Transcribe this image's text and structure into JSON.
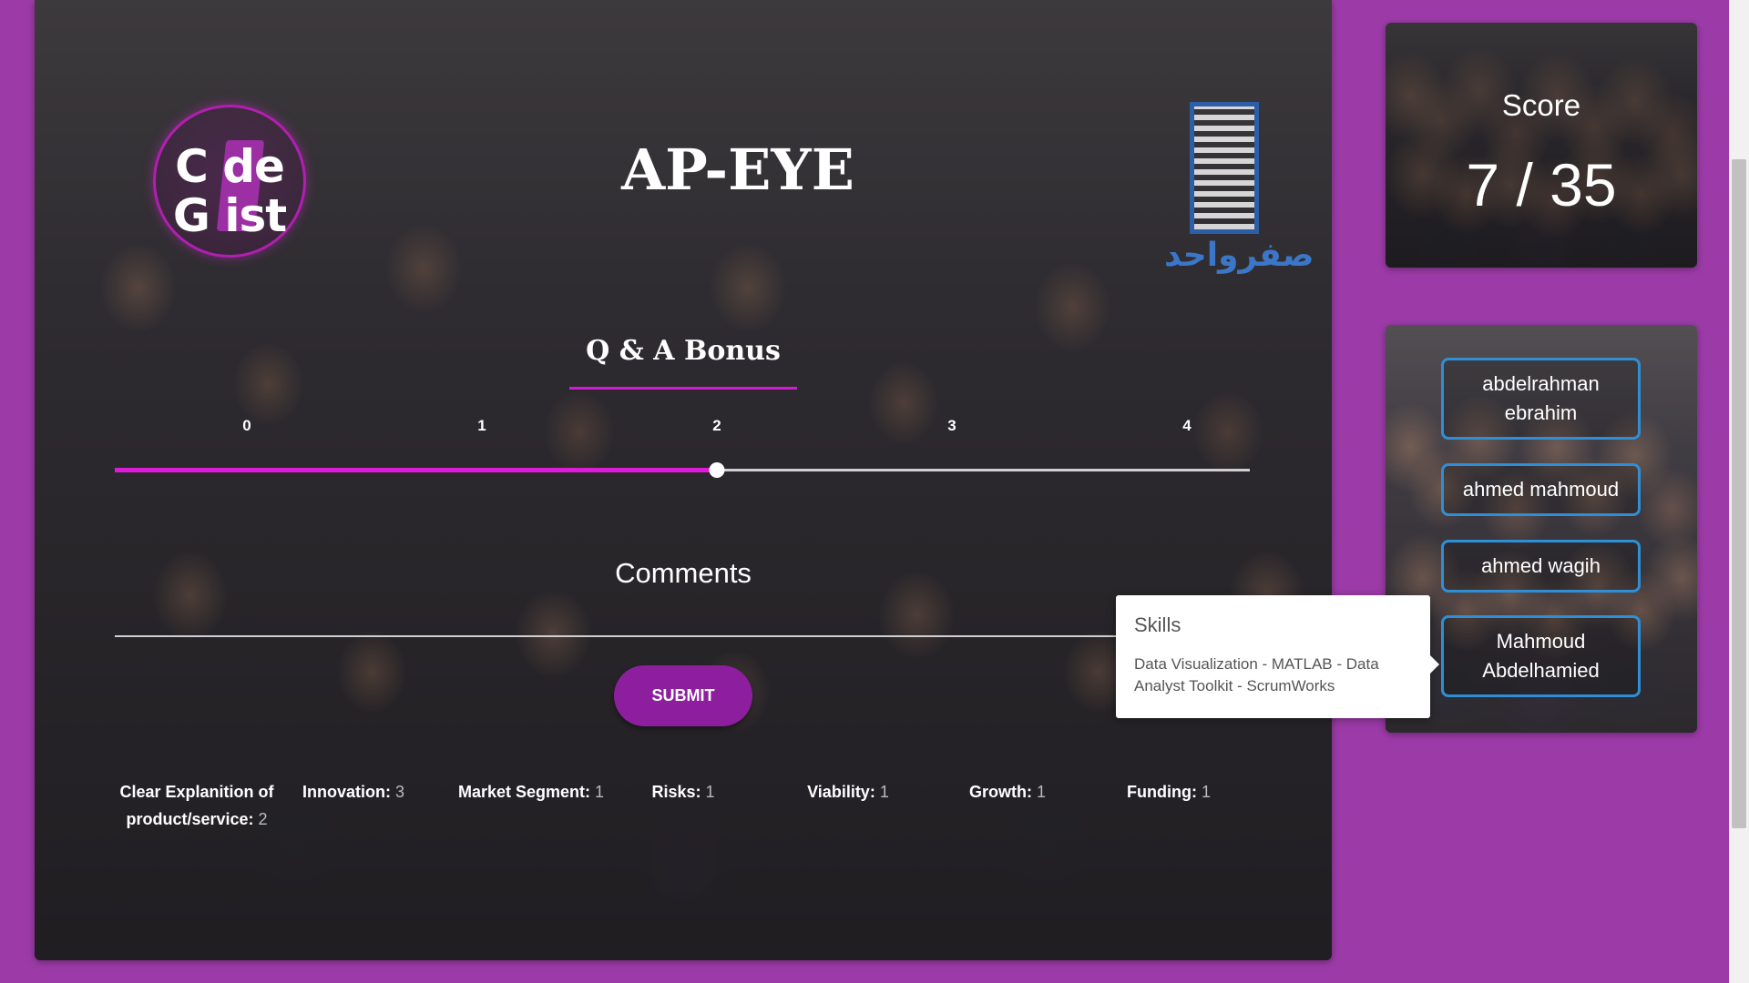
{
  "header": {
    "app_title": "AP-EYE",
    "codegist_logo": {
      "line1": "C  de",
      "line2": "G  ist",
      "name": "codegist-logo"
    },
    "sefr_logo": {
      "arabic": "صفرواحد"
    }
  },
  "qa_bonus": {
    "title": "Q & A Bonus",
    "ticks": [
      "0",
      "1",
      "2",
      "3",
      "4"
    ],
    "value": 2,
    "max": 4
  },
  "comments": {
    "label": "Comments",
    "value": ""
  },
  "submit": {
    "label": "SUBMIT"
  },
  "criteria": [
    {
      "label": "Clear Explanition of product/service:",
      "value": "2"
    },
    {
      "label": "Innovation:",
      "value": "3"
    },
    {
      "label": "Market Segment:",
      "value": "1"
    },
    {
      "label": "Risks:",
      "value": "1"
    },
    {
      "label": "Viability:",
      "value": "1"
    },
    {
      "label": "Growth:",
      "value": "1"
    },
    {
      "label": "Funding:",
      "value": "1"
    }
  ],
  "score": {
    "label": "Score",
    "value": "7 / 35"
  },
  "team": {
    "members": [
      {
        "name": "abdelrahman ebrahim"
      },
      {
        "name": "ahmed mahmoud"
      },
      {
        "name": "ahmed wagih"
      },
      {
        "name": "Mahmoud Abdelhamied"
      }
    ]
  },
  "tooltip": {
    "title": "Skills",
    "body": "Data Visualization - MATLAB - Data Analyst Toolkit - ScrumWorks"
  },
  "colors": {
    "page_bg": "#9c3ba8",
    "accent_pink": "#e01ad9",
    "submit_purple": "#8d1f9f",
    "member_border": "#2f8fd6"
  }
}
